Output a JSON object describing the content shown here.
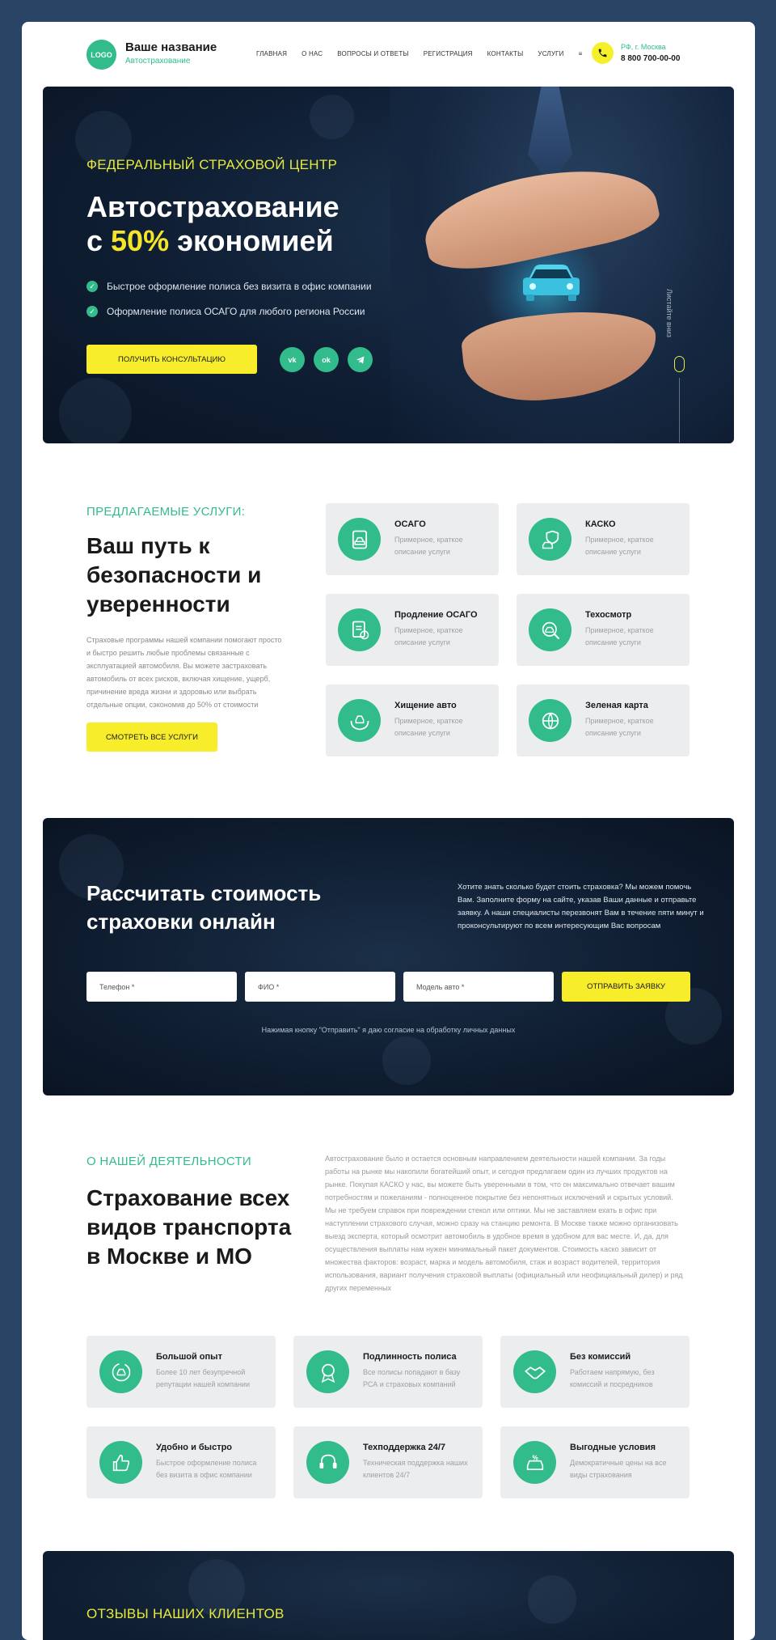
{
  "header": {
    "logo": "LOGO",
    "brand_name": "Ваше название",
    "brand_sub": "Автострахование",
    "nav": [
      "ГЛАВНАЯ",
      "О НАС",
      "ВОПРОСЫ И ОТВЕТЫ",
      "РЕГИСТРАЦИЯ",
      "КОНТАКТЫ",
      "УСЛУГИ",
      "≡"
    ],
    "location": "РФ, г. Москва",
    "phone": "8 800 700-00-00"
  },
  "hero": {
    "kicker": "ФЕДЕРАЛЬНЫЙ СТРАХОВОЙ ЦЕНТР",
    "title_line1": "Автострахование",
    "title_prefix": "с ",
    "title_accent": "50%",
    "title_suffix": " экономией",
    "bullets": [
      "Быстрое оформление полиса без визита в офис компании",
      "Оформление полиса ОСАГО для любого региона России"
    ],
    "button": "ПОЛУЧИТЬ КОНСУЛЬТАЦИЮ",
    "socials": [
      "vk",
      "ok",
      "telegram"
    ],
    "scroll_hint": "Листайте вниз"
  },
  "services": {
    "kicker": "ПРЕДЛАГАЕМЫЕ УСЛУГИ:",
    "title": "Ваш путь к безопасности и уверенности",
    "text": "Страховые программы нашей компании помогают просто и быстро решить любые проблемы связанные с эксплуатацией автомобиля. Вы можете застраховать автомобиль от всех рисков, включая хищение, ущерб, причинение вреда жизни и здоровью или выбрать отдельные опции, сэкономив до 50% от стоимости",
    "button": "СМОТРЕТЬ ВСЕ УСЛУГИ",
    "items": [
      {
        "title": "ОСАГО",
        "desc": "Примерное, краткое описание услуги",
        "icon": "car-document-icon"
      },
      {
        "title": "КАСКО",
        "desc": "Примерное, краткое описание услуги",
        "icon": "car-shield-icon"
      },
      {
        "title": "Продление ОСАГО",
        "desc": "Примерное, краткое описание услуги",
        "icon": "renew-document-icon"
      },
      {
        "title": "Техосмотр",
        "desc": "Примерное, краткое описание услуги",
        "icon": "inspection-icon"
      },
      {
        "title": "Хищение авто",
        "desc": "Примерное, краткое описание услуги",
        "icon": "hands-car-icon"
      },
      {
        "title": "Зеленая карта",
        "desc": "Примерное, краткое описание услуги",
        "icon": "globe-icon"
      }
    ]
  },
  "calc": {
    "title": "Рассчитать стоимость страховки онлайн",
    "text": "Хотите знать сколько будет стоить страховка? Мы можем помочь Вам. Заполните форму на сайте, указав Ваши данные и отправьте заявку. А наши специалисты перезвонят Вам в течение пяти минут и проконсультируют по всем интересующим Вас вопросам",
    "phone_placeholder": "Телефон *",
    "name_placeholder": "ФИО *",
    "model_placeholder": "Модель авто *",
    "button": "ОТПРАВИТЬ ЗАЯВКУ",
    "consent": "Нажимая кнопку \"Отправить\" я даю согласие на обработку личных данных"
  },
  "about": {
    "kicker": "О НАШЕЙ ДЕЯТЕЛЬНОСТИ",
    "title": "Страхование всех видов транспорта в Москве и МО",
    "text": "Автострахование было и остается основным направлением деятельности нашей компании. За годы работы на рынке мы накопили богатейший опыт, и сегодня предлагаем один из лучших продуктов на рынке. Покупая КАСКО у нас, вы можете быть уверенными в том, что он максимально отвечает вашим потребностям и пожеланиям - полноценное покрытие без непонятных исключений и скрытых условий. Мы не требуем справок при повреждении стекол или оптики. Мы не заставляем ехать в офис при наступлении страхового случая, можно сразу на станцию ремонта. В Москве также можно организовать выезд эксперта, который осмотрит автомобиль в удобное время в удобном для вас месте. И, да, для осуществления выплаты нам нужен минимальный пакет документов. Стоимость каско зависит от множества факторов: возраст, марка и модель автомобиля, стаж и возраст водителей, территория использования, вариант получения страховой выплаты (официальный или неофициальный дилер) и ряд других переменных",
    "features": [
      {
        "title": "Большой опыт",
        "desc": "Более 10 лет безупречной репутации нашей компании",
        "icon": "car-cycle-icon"
      },
      {
        "title": "Подлинность полиса",
        "desc": "Все полисы попадают в базу РСА и страховых компаний",
        "icon": "medal-icon"
      },
      {
        "title": "Без комиссий",
        "desc": "Работаем напрямую, без комиссий и посредников",
        "icon": "handshake-icon"
      },
      {
        "title": "Удобно и быстро",
        "desc": "Быстрое оформление полиса без визита в офис компании",
        "icon": "thumbs-up-icon"
      },
      {
        "title": "Техподдержка 24/7",
        "desc": "Техническая поддержка наших клиентов 24/7",
        "icon": "support-icon"
      },
      {
        "title": "Выгодные условия",
        "desc": "Демократичные цены на все виды страхования",
        "icon": "discount-car-icon"
      }
    ]
  },
  "reviews": {
    "kicker": "ОТЗЫВЫ НАШИХ КЛИЕНТОВ"
  },
  "colors": {
    "accent_green": "#32bc8b",
    "accent_yellow": "#f7ed2a",
    "dark_navy": "#0f1e33",
    "page_bg": "#2a4466"
  }
}
